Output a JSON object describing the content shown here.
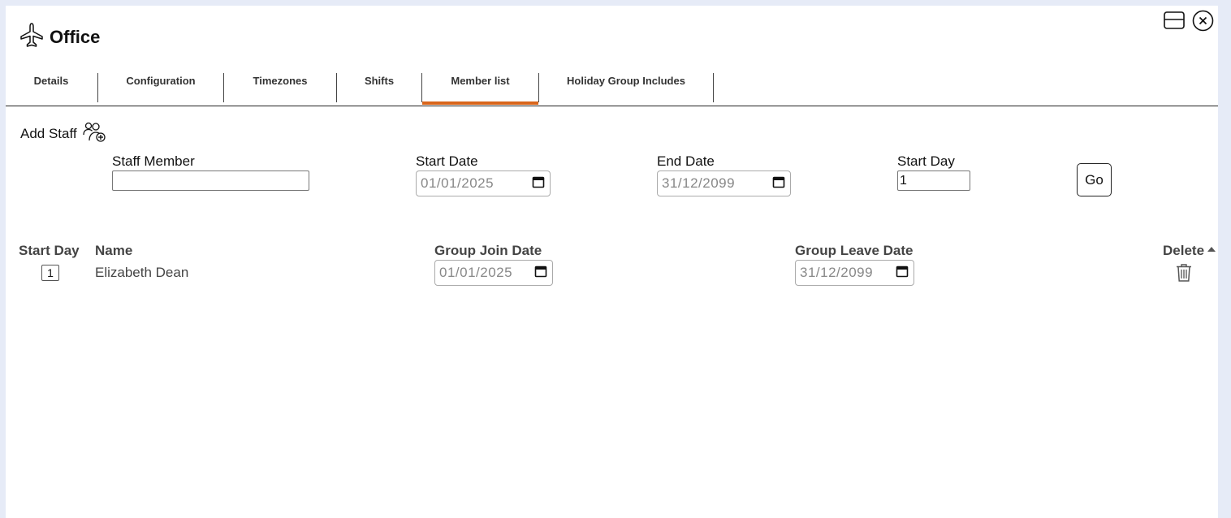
{
  "window": {
    "title": "Office",
    "title_icon": "airplane-icon",
    "header_buttons": [
      {
        "name": "window-layout-icon"
      },
      {
        "name": "close-circle-icon"
      }
    ]
  },
  "tabs": [
    {
      "label": "Details",
      "active": false
    },
    {
      "label": "Configuration",
      "active": false
    },
    {
      "label": "Timezones",
      "active": false
    },
    {
      "label": "Shifts",
      "active": false
    },
    {
      "label": "Member list",
      "active": true
    },
    {
      "label": "Holiday Group Includes",
      "active": false
    }
  ],
  "add_staff": {
    "label": "Add Staff",
    "icon": "add-user-group-icon"
  },
  "form": {
    "staff_member_label": "Staff Member",
    "staff_member_value": "",
    "start_date_label": "Start Date",
    "start_date_value": "01/01/2025",
    "end_date_label": "End Date",
    "end_date_value": "31/12/2099",
    "start_day_label": "Start Day",
    "start_day_value": "1",
    "go_label": "Go"
  },
  "table": {
    "headers": {
      "start_day": "Start Day",
      "name": "Name",
      "join_date": "Group Join Date",
      "leave_date": "Group Leave Date",
      "delete": "Delete"
    },
    "rows": [
      {
        "start_day": "1",
        "name": "Elizabeth Dean",
        "join_date": "01/01/2025",
        "leave_date": "31/12/2099"
      }
    ]
  },
  "colors": {
    "accent": "#d9661c",
    "background": "#e6ebf7"
  }
}
